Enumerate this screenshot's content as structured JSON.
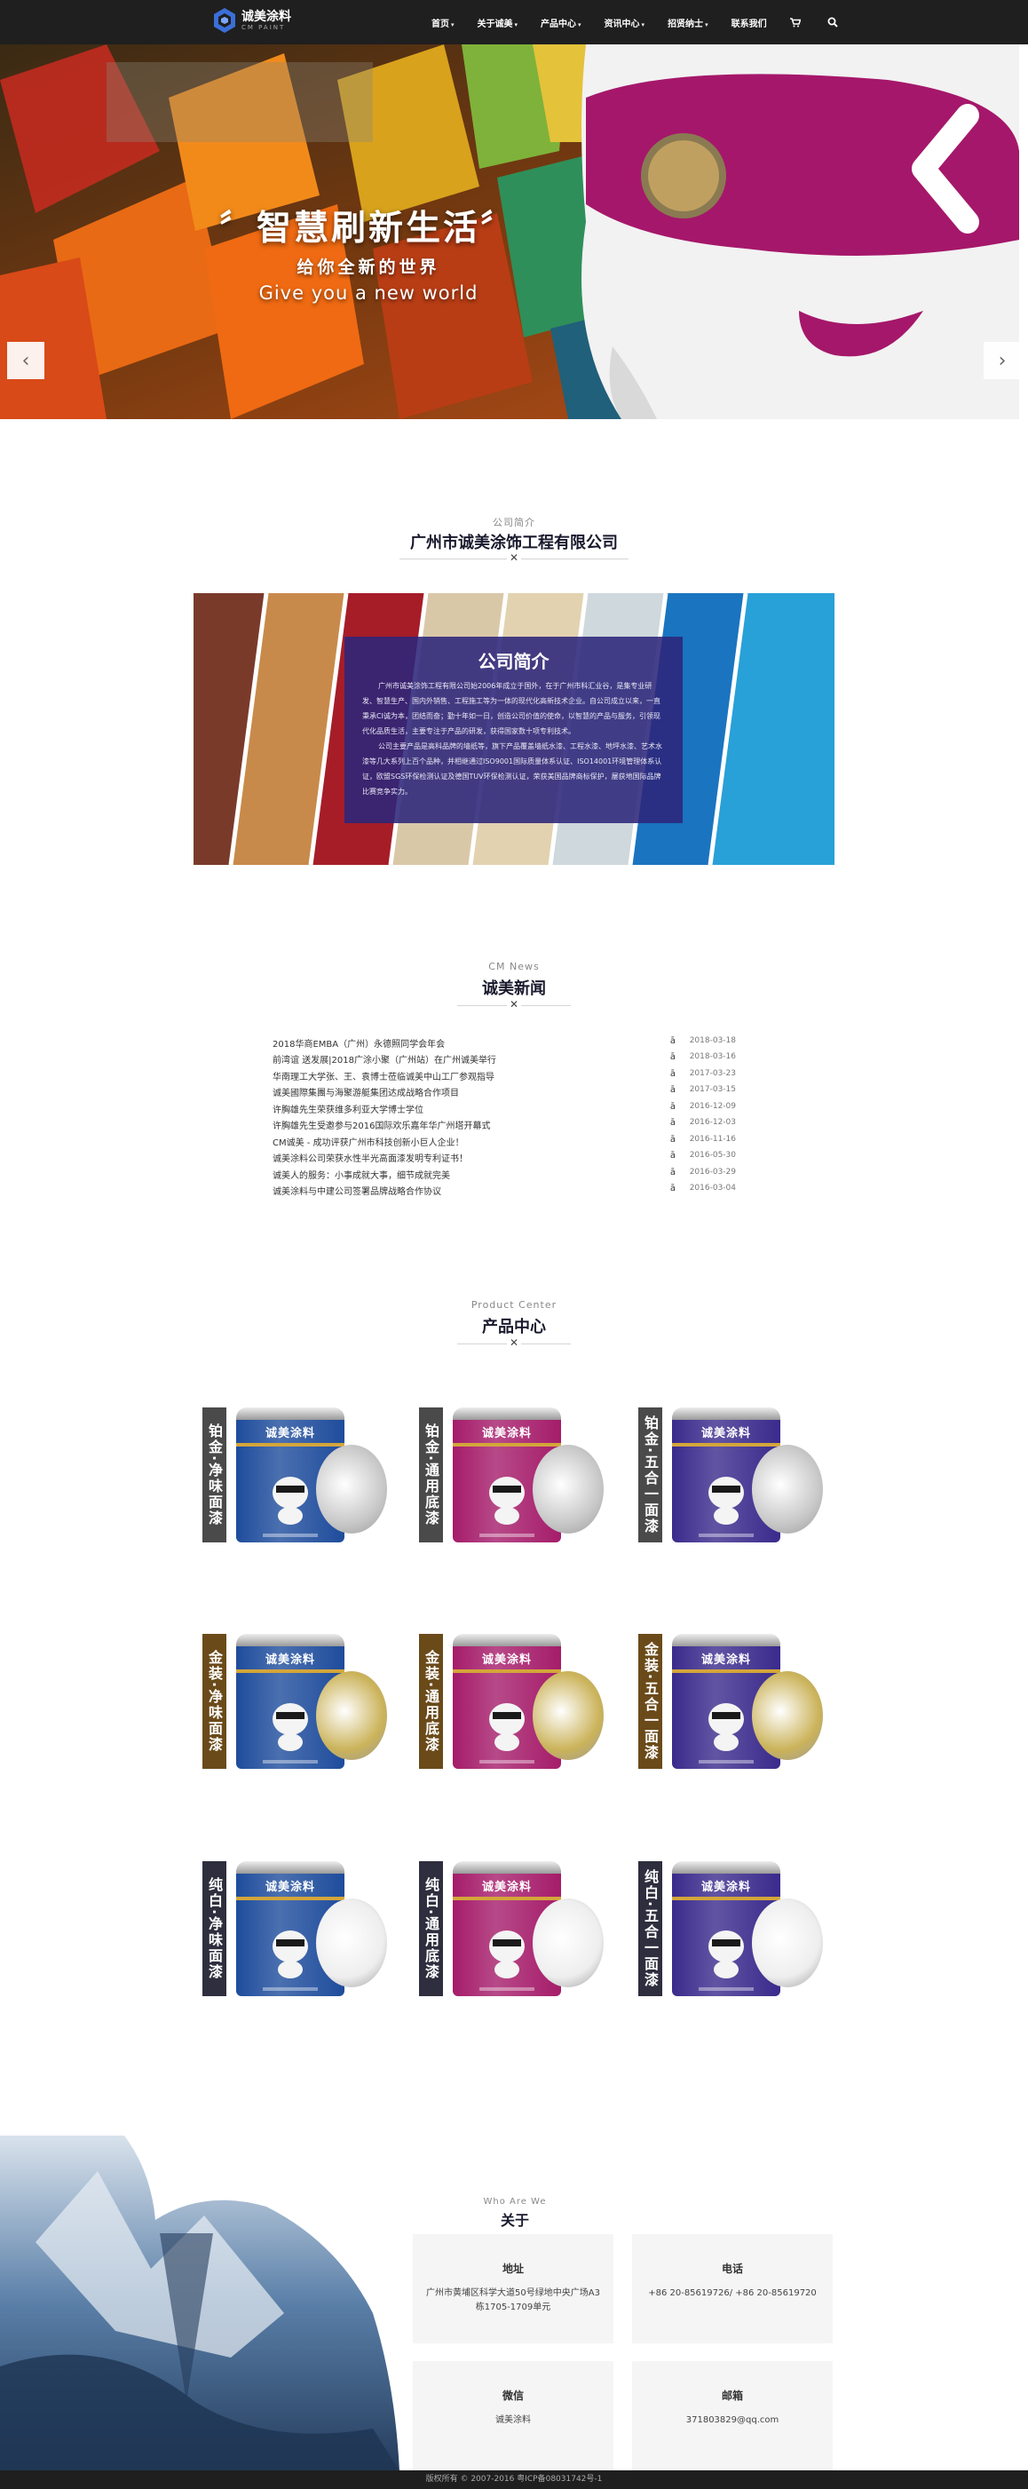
{
  "nav": {
    "logo_cn": "诚美涂料",
    "logo_en": "CM PAINT",
    "items": [
      {
        "label": "首页",
        "caret": "▾"
      },
      {
        "label": "关于诚美",
        "caret": "▾"
      },
      {
        "label": "产品中心",
        "caret": "▾"
      },
      {
        "label": "资讯中心",
        "caret": "▾"
      },
      {
        "label": "招贤纳士",
        "caret": "▾"
      },
      {
        "label": "联系我们",
        "caret": ""
      }
    ],
    "cart_icon": "cart-icon",
    "search_icon": "search-icon"
  },
  "hero": {
    "tagline": "〞智慧刷新生活〞",
    "subtitle": "给你全新的世界",
    "english": "Give you a new world",
    "prev": "‹",
    "next": "›"
  },
  "intro": {
    "section_en": "公司简介",
    "section_cn": "广州市诚美涂饰工程有限公司",
    "box_title": "公司简介",
    "box_text_1": "广州市诚美涂饰工程有限公司始2006年成立于国外，在于广州市科汇业谷，是集专业研发、智慧生产、国内外销售、工程施工等为一体的现代化高新技术企业。自公司成立以来，一直秉承CI诚为本，团结而奋；勤十年如一日，创造公司价值的使命，以智慧的产品与服务，引领现代化品质生活，主要专注于产品的研发，获得国家数十项专利技术。",
    "box_text_2": "公司主要产品是高科品牌的墙纸等，旗下产品覆盖墙纸水漆、工程水漆、地坪水漆、艺术水漆等几大系列上百个品种，并相继通过ISO9001国际质量体系认证、ISO14001环境管理体系认证，欧盟SGS环保检测认证及德国TUV环保检测认证，荣获美国品牌商标保护，屡获地国际品牌比赛竞争实力。"
  },
  "news": {
    "section_en": "CM News",
    "section_cn": "诚美新闻",
    "icon": "ā",
    "items": [
      {
        "title": "2018华商EMBA（广州）永德照同学会年会",
        "date": "2018-03-18"
      },
      {
        "title": "前湾谊 送发展|2018广涂小聚（广州站）在广州诚美举行",
        "date": "2018-03-16"
      },
      {
        "title": "华南理工大学张、王、袁博士莅临诚美中山工厂参观指导",
        "date": "2017-03-23"
      },
      {
        "title": "诚美國際集團与海聚游艇集团达成战略合作项目",
        "date": "2017-03-15"
      },
      {
        "title": "许胸雄先生荣获维多利亚大学博士学位",
        "date": "2016-12-09"
      },
      {
        "title": "许胸雄先生受邀参与2016国际欢乐嘉年华广州塔开幕式",
        "date": "2016-12-03"
      },
      {
        "title": "CM诚美 - 成功评获广州市科技创新小巨人企业！",
        "date": "2016-11-16"
      },
      {
        "title": "诚美涂料公司荣获水性半光高面漆发明专利证书！",
        "date": "2016-05-30"
      },
      {
        "title": "诚美人的服务：小事成就大事，细节成就完美",
        "date": "2016-03-29"
      },
      {
        "title": "诚美涂料与中建公司签署品牌战略合作协议",
        "date": "2016-03-04"
      }
    ]
  },
  "products": {
    "section_en": "Product Center",
    "section_cn": "产品中心",
    "brand": "诚美涂料",
    "items": [
      {
        "label": "铂金·净味面漆",
        "label_color": "#4a4a4a",
        "can_color": "#1e4c9c",
        "disc_color": "#c8c8c8"
      },
      {
        "label": "铂金·通用底漆",
        "label_color": "#4a4a4a",
        "can_color": "#a51c6a",
        "disc_color": "#c8c8c8"
      },
      {
        "label": "铂金·五合一面漆",
        "label_color": "#4a4a4a",
        "can_color": "#3a2a8c",
        "disc_color": "#c8c8c8"
      },
      {
        "label": "金装·净味面漆",
        "label_color": "#6b4a1a",
        "can_color": "#1e4c9c",
        "disc_color": "#cbb35a"
      },
      {
        "label": "金装·通用底漆",
        "label_color": "#6b4a1a",
        "can_color": "#a51c6a",
        "disc_color": "#cbb35a"
      },
      {
        "label": "金装·五合一面漆",
        "label_color": "#6b4a1a",
        "can_color": "#3a2a8c",
        "disc_color": "#cbb35a"
      },
      {
        "label": "纯白·净味面漆",
        "label_color": "#2e2e3e",
        "can_color": "#1e4c9c",
        "disc_color": "#eeeeee"
      },
      {
        "label": "纯白·通用底漆",
        "label_color": "#2e2e3e",
        "can_color": "#a51c6a",
        "disc_color": "#eeeeee"
      },
      {
        "label": "纯白·五合一面漆",
        "label_color": "#2e2e3e",
        "can_color": "#3a2a8c",
        "disc_color": "#eeeeee"
      }
    ]
  },
  "about": {
    "section_en": "Who Are We",
    "section_cn": "关于",
    "cards": [
      {
        "heading": "地址",
        "value": "广州市黄埔区科学大道50号绿地中央广场A3栋1705-1709单元"
      },
      {
        "heading": "电话",
        "value": "+86 20-85619726/ +86 20-85619720"
      },
      {
        "heading": "微信",
        "value": "诚美涂料"
      },
      {
        "heading": "邮箱",
        "value": "371803829@qq.com"
      }
    ]
  },
  "footer": {
    "text": "版权所有 © 2007-2016 粤ICP备08031742号-1"
  }
}
